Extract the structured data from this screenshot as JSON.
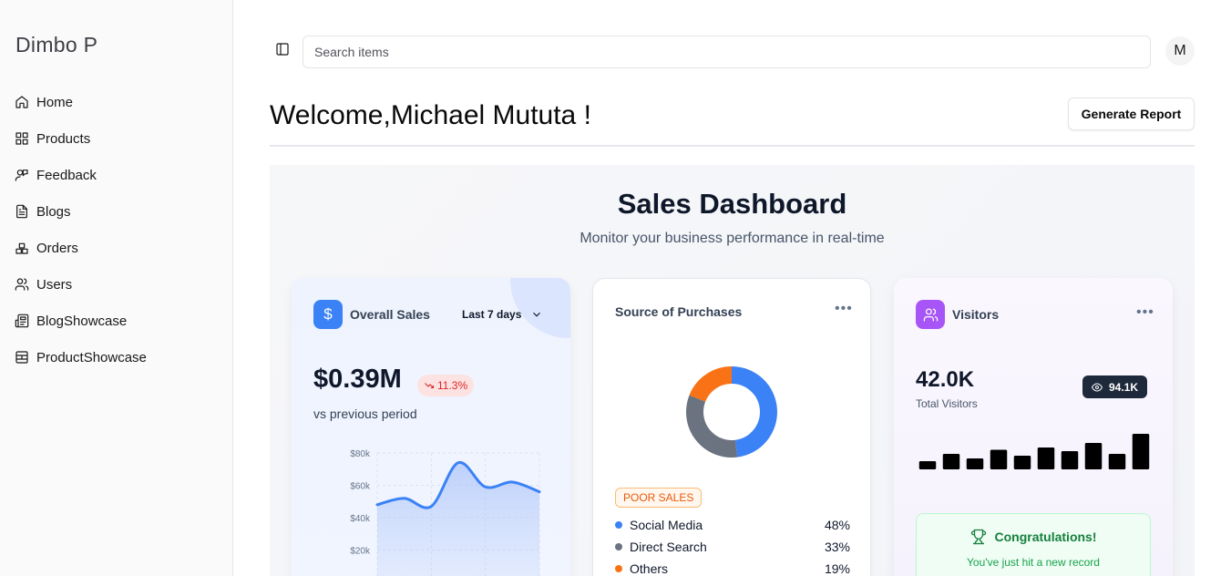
{
  "sidebar": {
    "brand": "Dimbo P",
    "items": [
      {
        "label": "Home",
        "icon": "home-icon"
      },
      {
        "label": "Products",
        "icon": "grid-icon"
      },
      {
        "label": "Feedback",
        "icon": "feedback-icon"
      },
      {
        "label": "Blogs",
        "icon": "file-text-icon"
      },
      {
        "label": "Orders",
        "icon": "orders-icon"
      },
      {
        "label": "Users",
        "icon": "users-icon"
      },
      {
        "label": "BlogShowcase",
        "icon": "newspaper-icon"
      },
      {
        "label": "ProductShowcase",
        "icon": "layout-icon"
      }
    ]
  },
  "header": {
    "search_placeholder": "Search items",
    "avatar_initial": "M",
    "welcome": "Welcome,Michael Mututa !",
    "generate_report": "Generate Report"
  },
  "dashboard": {
    "title": "Sales Dashboard",
    "subtitle": "Monitor your business performance in real-time"
  },
  "overall_sales": {
    "title": "Overall Sales",
    "period": "Last 7 days",
    "amount": "$0.39M",
    "change": "11.3%",
    "comparison": "vs previous period",
    "accent": "#3b82f6",
    "change_color": "#dc2626"
  },
  "purchases": {
    "title": "Source of Purchases",
    "badge": "POOR SALES",
    "legend": [
      {
        "name": "Social Media",
        "pct": "48%",
        "color": "#3b82f6"
      },
      {
        "name": "Direct Search",
        "pct": "33%",
        "color": "#6b7280"
      },
      {
        "name": "Others",
        "pct": "19%",
        "color": "#f97316"
      }
    ]
  },
  "visitors": {
    "title": "Visitors",
    "total": "42.0K",
    "total_label": "Total Visitors",
    "views": "94.1K",
    "congrats_title": "Congratulations!",
    "congrats_text": "You've just hit a new record",
    "accent": "#a855f7"
  },
  "chart_data": [
    {
      "type": "area",
      "title": "",
      "ytick_labels": [
        "$80k",
        "$60k",
        "$40k",
        "$20k"
      ],
      "ylim": [
        10000,
        80000
      ],
      "x": [
        0,
        1,
        2,
        3,
        4,
        5,
        6
      ],
      "values": [
        48000,
        52000,
        47000,
        74000,
        59000,
        62000,
        56000
      ],
      "grid": true,
      "color": "#3b82f6"
    },
    {
      "type": "pie",
      "title": "",
      "categories": [
        "Social Media",
        "Direct Search",
        "Others"
      ],
      "values": [
        48,
        33,
        19
      ],
      "colors": [
        "#3b82f6",
        "#6b7280",
        "#f97316"
      ]
    },
    {
      "type": "bar",
      "title": "",
      "values": [
        18,
        34,
        24,
        43,
        30,
        48,
        40,
        58,
        34,
        78
      ],
      "ylim": [
        0,
        80
      ],
      "color": "#000000"
    }
  ]
}
